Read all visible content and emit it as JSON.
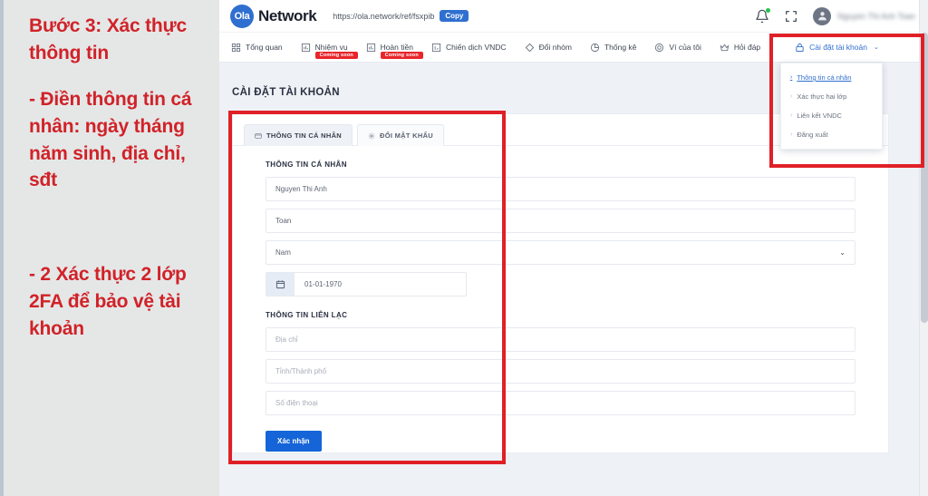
{
  "annotation": {
    "heading": "Bước 3: Xác thực thông tin",
    "point_1": "- Điền thông tin cá nhân: ngày tháng năm sinh, địa chỉ, sđt",
    "point_2": "- 2 Xác thực 2 lớp 2FA để bảo vệ tài khoản",
    "color": "#d12228"
  },
  "topbar": {
    "logo_text": "Ola",
    "brand_name": "Network",
    "ref_url": "https://ola.network/ref/fsxpib",
    "copy_label": "Copy",
    "notification_icon": "bell-icon",
    "fullscreen_icon": "fullscreen-icon",
    "avatar_icon": "avatar",
    "user_name": "Nguyen Thi Anh Toan",
    "notification_dot_color": "#27c24c",
    "brand_color": "#2f6fd0"
  },
  "nav": {
    "items": [
      {
        "label": "Tổng quan",
        "icon": "grid-icon",
        "badge": ""
      },
      {
        "label": "Nhiệm vụ",
        "icon": "chart-bar-icon",
        "badge": "Coming soon"
      },
      {
        "label": "Hoàn tiền",
        "icon": "chart-bar-icon",
        "badge": "Coming soon"
      },
      {
        "label": "Chiến dịch VNDC",
        "icon": "chart-column-icon",
        "badge": ""
      },
      {
        "label": "Đổi nhóm",
        "icon": "diamond-icon",
        "badge": ""
      },
      {
        "label": "Thống kê",
        "icon": "pie-chart-icon",
        "badge": ""
      },
      {
        "label": "Ví của tôi",
        "icon": "coin-icon",
        "badge": ""
      },
      {
        "label": "Hỏi đáp",
        "icon": "crown-icon",
        "badge": ""
      }
    ],
    "settings": {
      "label": "Cài đặt tài khoản",
      "icon": "lock-icon",
      "chevron": "⌄",
      "color": "#2f6fd0"
    }
  },
  "dropdown": {
    "items": [
      {
        "label": "Thông tin cá nhân",
        "active": true
      },
      {
        "label": "Xác thực hai lớp",
        "active": false
      },
      {
        "label": "Liên kết VNDC",
        "active": false
      },
      {
        "label": "Đăng xuất",
        "active": false
      }
    ]
  },
  "page": {
    "title": "CÀI ĐẶT TÀI KHOẢN",
    "tabs": [
      {
        "label": "THÔNG TIN CÁ NHÂN",
        "icon": "id-card-icon",
        "active": true
      },
      {
        "label": "ĐỔI MẬT KHẨU",
        "icon": "gear-icon",
        "active": false
      }
    ],
    "personal_section": {
      "heading": "THÔNG TIN CÁ NHÂN",
      "fields": [
        {
          "name": "last-name",
          "value": "Nguyen Thi Anh",
          "placeholder": ""
        },
        {
          "name": "first-name",
          "value": "Toan",
          "placeholder": ""
        },
        {
          "name": "gender",
          "value": "Nam",
          "placeholder": "",
          "chevron": "⌄"
        }
      ],
      "birthday": {
        "icon": "calendar-icon",
        "value": "01-01-1970"
      }
    },
    "contact_section": {
      "heading": "THÔNG TIN LIÊN LẠC",
      "fields": [
        {
          "name": "address",
          "value": "",
          "placeholder": "Địa chỉ"
        },
        {
          "name": "city",
          "value": "",
          "placeholder": "Tỉnh/Thành phố"
        },
        {
          "name": "phone",
          "value": "",
          "placeholder": "Số điện thoại"
        }
      ]
    },
    "submit_label": "Xác nhận",
    "submit_color": "#1565d8"
  },
  "highlight_color": "#e02027"
}
